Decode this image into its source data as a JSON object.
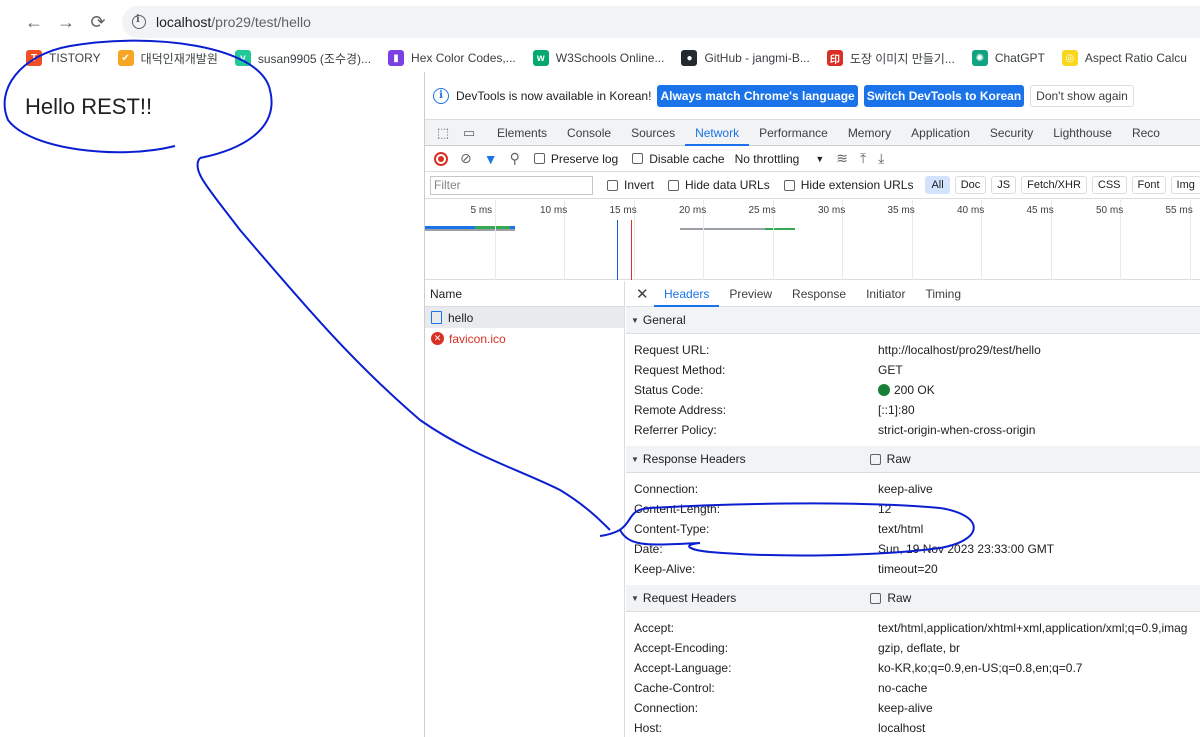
{
  "browser": {
    "url_host": "localhost",
    "url_path": "/pro29/test/hello",
    "bookmarks": [
      {
        "label": "TISTORY",
        "icon": "tistory-icon",
        "color": "#f04e23",
        "glyph": "T"
      },
      {
        "label": "대덕인재개발원",
        "icon": "ddit-logo-icon",
        "color": "#f6a623",
        "glyph": "✔"
      },
      {
        "label": "susan9905 (조수경)...",
        "icon": "velog-icon",
        "color": "#20c997",
        "glyph": "v"
      },
      {
        "label": "Hex Color Codes,...",
        "icon": "palette-icon",
        "color": "#7b3fe4",
        "glyph": "▮"
      },
      {
        "label": "W3Schools Online...",
        "icon": "w3schools-icon",
        "color": "#04aa6d",
        "glyph": "w"
      },
      {
        "label": "GitHub - jangmi-B...",
        "icon": "github-icon",
        "color": "#24292f",
        "glyph": "●"
      },
      {
        "label": "도장 이미지 만들기...",
        "icon": "stamp-icon",
        "color": "#d93025",
        "glyph": "印"
      },
      {
        "label": "ChatGPT",
        "icon": "chatgpt-icon",
        "color": "#10a37f",
        "glyph": "✺"
      },
      {
        "label": "Aspect Ratio Calcu",
        "icon": "aspect-ratio-icon",
        "color": "#f9d71c",
        "glyph": "◎"
      }
    ]
  },
  "page": {
    "body_text": "Hello REST!!"
  },
  "devtools": {
    "infobar": {
      "text": "DevTools is now available in Korean!",
      "btn_match": "Always match Chrome's language",
      "btn_switch": "Switch DevTools to Korean",
      "btn_dismiss": "Don't show again"
    },
    "tabs": [
      "Elements",
      "Console",
      "Sources",
      "Network",
      "Performance",
      "Memory",
      "Application",
      "Security",
      "Lighthouse",
      "Reco"
    ],
    "active_tab": "Network",
    "network_toolbar": {
      "preserve_log": "Preserve log",
      "disable_cache": "Disable cache",
      "throttling": "No throttling"
    },
    "filter": {
      "placeholder": "Filter",
      "invert": "Invert",
      "hide_data_urls": "Hide data URLs",
      "hide_ext_urls": "Hide extension URLs",
      "chips": [
        "All",
        "Doc",
        "JS",
        "Fetch/XHR",
        "CSS",
        "Font",
        "Img"
      ]
    },
    "timeline_ticks": [
      "5 ms",
      "10 ms",
      "15 ms",
      "20 ms",
      "25 ms",
      "30 ms",
      "35 ms",
      "40 ms",
      "45 ms",
      "50 ms",
      "55 ms"
    ],
    "requests": {
      "header": "Name",
      "items": [
        {
          "name": "hello",
          "status": "ok"
        },
        {
          "name": "favicon.ico",
          "status": "error"
        }
      ]
    },
    "detail_tabs": [
      "Headers",
      "Preview",
      "Response",
      "Initiator",
      "Timing"
    ],
    "general": {
      "title": "General",
      "rows": [
        {
          "k": "Request URL:",
          "v": "http://localhost/pro29/test/hello"
        },
        {
          "k": "Request Method:",
          "v": "GET"
        },
        {
          "k": "Status Code:",
          "v": "200 OK"
        },
        {
          "k": "Remote Address:",
          "v": "[::1]:80"
        },
        {
          "k": "Referrer Policy:",
          "v": "strict-origin-when-cross-origin"
        }
      ]
    },
    "response_headers": {
      "title": "Response Headers",
      "raw": "Raw",
      "rows": [
        {
          "k": "Connection:",
          "v": "keep-alive"
        },
        {
          "k": "Content-Length:",
          "v": "12"
        },
        {
          "k": "Content-Type:",
          "v": "text/html"
        },
        {
          "k": "Date:",
          "v": "Sun, 19 Nov 2023 23:33:00 GMT"
        },
        {
          "k": "Keep-Alive:",
          "v": "timeout=20"
        }
      ]
    },
    "request_headers": {
      "title": "Request Headers",
      "raw": "Raw",
      "rows": [
        {
          "k": "Accept:",
          "v": "text/html,application/xhtml+xml,application/xml;q=0.9,imag"
        },
        {
          "k": "Accept-Encoding:",
          "v": "gzip, deflate, br"
        },
        {
          "k": "Accept-Language:",
          "v": "ko-KR,ko;q=0.9,en-US;q=0.8,en;q=0.7"
        },
        {
          "k": "Cache-Control:",
          "v": "no-cache"
        },
        {
          "k": "Connection:",
          "v": "keep-alive"
        },
        {
          "k": "Host:",
          "v": "localhost"
        }
      ]
    }
  },
  "annotation_color": "#0b1fd1"
}
